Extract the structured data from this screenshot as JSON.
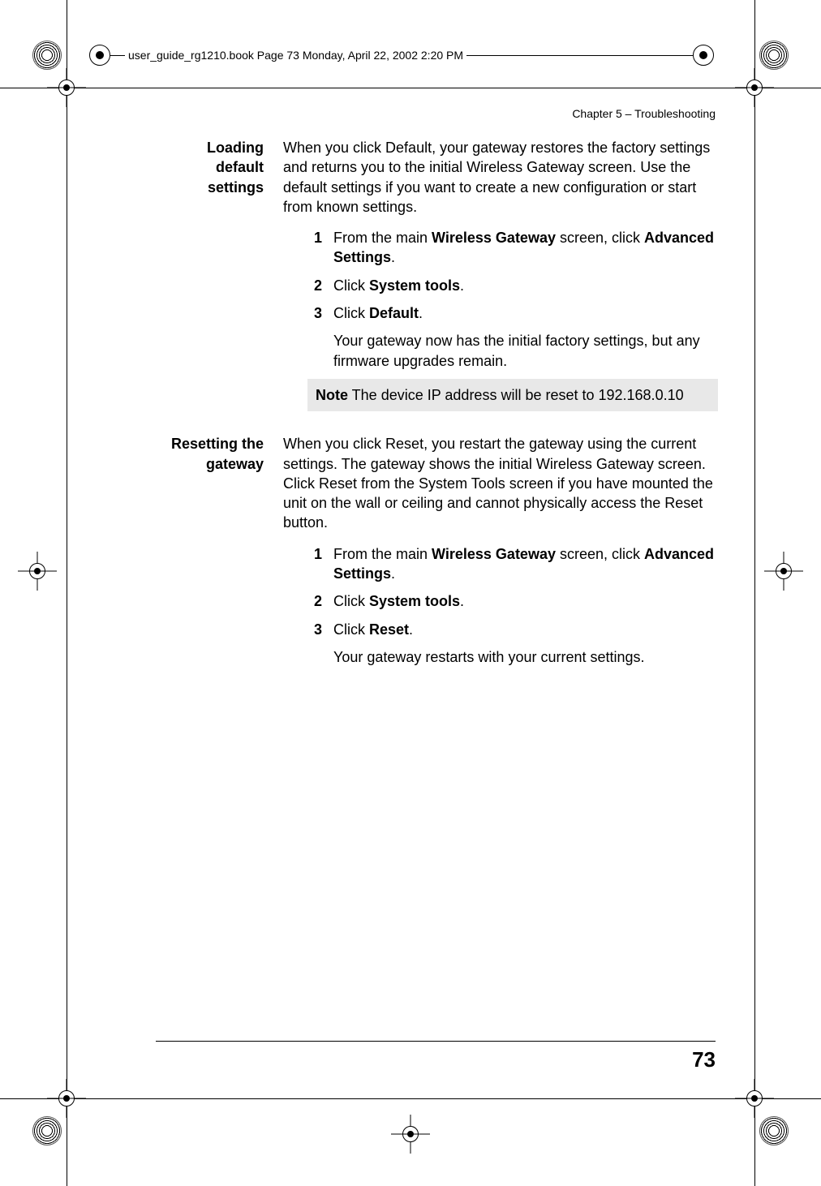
{
  "header_filename": "user_guide_rg1210.book  Page 73  Monday, April 22, 2002  2:20 PM",
  "chapter_header": "Chapter 5  –  Troubleshooting",
  "page_number": "73",
  "sections": [
    {
      "heading": "Loading default settings",
      "intro": "When you click Default, your gateway restores the factory settings and returns you to the initial Wireless Gateway screen. Use the default settings if you want to create a new configuration or start from known settings.",
      "steps": [
        {
          "num": "1",
          "pre": "From the main ",
          "bold1": "Wireless Gateway",
          "mid": " screen, click ",
          "bold2": "Advanced Settings",
          "post": "."
        },
        {
          "num": "2",
          "pre": "Click ",
          "bold1": "System tools",
          "mid": "",
          "bold2": "",
          "post": "."
        },
        {
          "num": "3",
          "pre": "Click ",
          "bold1": "Default",
          "mid": "",
          "bold2": "",
          "post": "."
        }
      ],
      "after_steps": "Your gateway now has the initial factory settings, but any firmware upgrades remain.",
      "note_label": "Note",
      "note_body": "   The device IP address will be reset to 192.168.0.10"
    },
    {
      "heading": "Resetting the gateway",
      "intro": "When you click Reset, you restart the gateway using the current settings. The gateway shows the initial Wireless Gateway screen. Click Reset from the System Tools screen if you have mounted the unit on the wall or ceiling and cannot physically access the Reset button.",
      "steps": [
        {
          "num": "1",
          "pre": "From the main ",
          "bold1": "Wireless Gateway",
          "mid": " screen, click ",
          "bold2": "Advanced Settings",
          "post": "."
        },
        {
          "num": "2",
          "pre": "Click ",
          "bold1": "System tools",
          "mid": "",
          "bold2": "",
          "post": "."
        },
        {
          "num": "3",
          "pre": "Click ",
          "bold1": "Reset",
          "mid": "",
          "bold2": "",
          "post": "."
        }
      ],
      "after_steps": "Your gateway restarts with your current settings."
    }
  ]
}
